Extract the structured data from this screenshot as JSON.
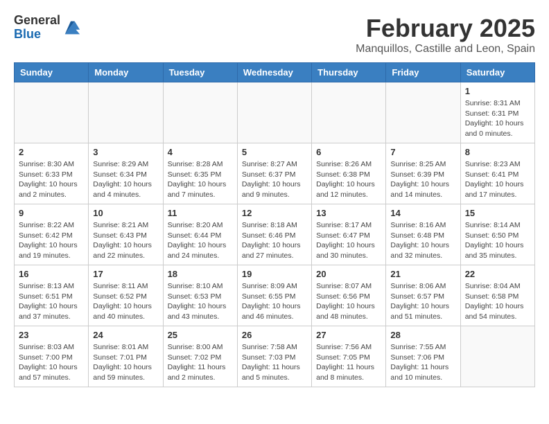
{
  "header": {
    "logo_line1": "General",
    "logo_line2": "Blue",
    "month": "February 2025",
    "location": "Manquillos, Castille and Leon, Spain"
  },
  "weekdays": [
    "Sunday",
    "Monday",
    "Tuesday",
    "Wednesday",
    "Thursday",
    "Friday",
    "Saturday"
  ],
  "weeks": [
    [
      {
        "day": "",
        "info": ""
      },
      {
        "day": "",
        "info": ""
      },
      {
        "day": "",
        "info": ""
      },
      {
        "day": "",
        "info": ""
      },
      {
        "day": "",
        "info": ""
      },
      {
        "day": "",
        "info": ""
      },
      {
        "day": "1",
        "info": "Sunrise: 8:31 AM\nSunset: 6:31 PM\nDaylight: 10 hours\nand 0 minutes."
      }
    ],
    [
      {
        "day": "2",
        "info": "Sunrise: 8:30 AM\nSunset: 6:33 PM\nDaylight: 10 hours\nand 2 minutes."
      },
      {
        "day": "3",
        "info": "Sunrise: 8:29 AM\nSunset: 6:34 PM\nDaylight: 10 hours\nand 4 minutes."
      },
      {
        "day": "4",
        "info": "Sunrise: 8:28 AM\nSunset: 6:35 PM\nDaylight: 10 hours\nand 7 minutes."
      },
      {
        "day": "5",
        "info": "Sunrise: 8:27 AM\nSunset: 6:37 PM\nDaylight: 10 hours\nand 9 minutes."
      },
      {
        "day": "6",
        "info": "Sunrise: 8:26 AM\nSunset: 6:38 PM\nDaylight: 10 hours\nand 12 minutes."
      },
      {
        "day": "7",
        "info": "Sunrise: 8:25 AM\nSunset: 6:39 PM\nDaylight: 10 hours\nand 14 minutes."
      },
      {
        "day": "8",
        "info": "Sunrise: 8:23 AM\nSunset: 6:41 PM\nDaylight: 10 hours\nand 17 minutes."
      }
    ],
    [
      {
        "day": "9",
        "info": "Sunrise: 8:22 AM\nSunset: 6:42 PM\nDaylight: 10 hours\nand 19 minutes."
      },
      {
        "day": "10",
        "info": "Sunrise: 8:21 AM\nSunset: 6:43 PM\nDaylight: 10 hours\nand 22 minutes."
      },
      {
        "day": "11",
        "info": "Sunrise: 8:20 AM\nSunset: 6:44 PM\nDaylight: 10 hours\nand 24 minutes."
      },
      {
        "day": "12",
        "info": "Sunrise: 8:18 AM\nSunset: 6:46 PM\nDaylight: 10 hours\nand 27 minutes."
      },
      {
        "day": "13",
        "info": "Sunrise: 8:17 AM\nSunset: 6:47 PM\nDaylight: 10 hours\nand 30 minutes."
      },
      {
        "day": "14",
        "info": "Sunrise: 8:16 AM\nSunset: 6:48 PM\nDaylight: 10 hours\nand 32 minutes."
      },
      {
        "day": "15",
        "info": "Sunrise: 8:14 AM\nSunset: 6:50 PM\nDaylight: 10 hours\nand 35 minutes."
      }
    ],
    [
      {
        "day": "16",
        "info": "Sunrise: 8:13 AM\nSunset: 6:51 PM\nDaylight: 10 hours\nand 37 minutes."
      },
      {
        "day": "17",
        "info": "Sunrise: 8:11 AM\nSunset: 6:52 PM\nDaylight: 10 hours\nand 40 minutes."
      },
      {
        "day": "18",
        "info": "Sunrise: 8:10 AM\nSunset: 6:53 PM\nDaylight: 10 hours\nand 43 minutes."
      },
      {
        "day": "19",
        "info": "Sunrise: 8:09 AM\nSunset: 6:55 PM\nDaylight: 10 hours\nand 46 minutes."
      },
      {
        "day": "20",
        "info": "Sunrise: 8:07 AM\nSunset: 6:56 PM\nDaylight: 10 hours\nand 48 minutes."
      },
      {
        "day": "21",
        "info": "Sunrise: 8:06 AM\nSunset: 6:57 PM\nDaylight: 10 hours\nand 51 minutes."
      },
      {
        "day": "22",
        "info": "Sunrise: 8:04 AM\nSunset: 6:58 PM\nDaylight: 10 hours\nand 54 minutes."
      }
    ],
    [
      {
        "day": "23",
        "info": "Sunrise: 8:03 AM\nSunset: 7:00 PM\nDaylight: 10 hours\nand 57 minutes."
      },
      {
        "day": "24",
        "info": "Sunrise: 8:01 AM\nSunset: 7:01 PM\nDaylight: 10 hours\nand 59 minutes."
      },
      {
        "day": "25",
        "info": "Sunrise: 8:00 AM\nSunset: 7:02 PM\nDaylight: 11 hours\nand 2 minutes."
      },
      {
        "day": "26",
        "info": "Sunrise: 7:58 AM\nSunset: 7:03 PM\nDaylight: 11 hours\nand 5 minutes."
      },
      {
        "day": "27",
        "info": "Sunrise: 7:56 AM\nSunset: 7:05 PM\nDaylight: 11 hours\nand 8 minutes."
      },
      {
        "day": "28",
        "info": "Sunrise: 7:55 AM\nSunset: 7:06 PM\nDaylight: 11 hours\nand 10 minutes."
      },
      {
        "day": "",
        "info": ""
      }
    ]
  ]
}
